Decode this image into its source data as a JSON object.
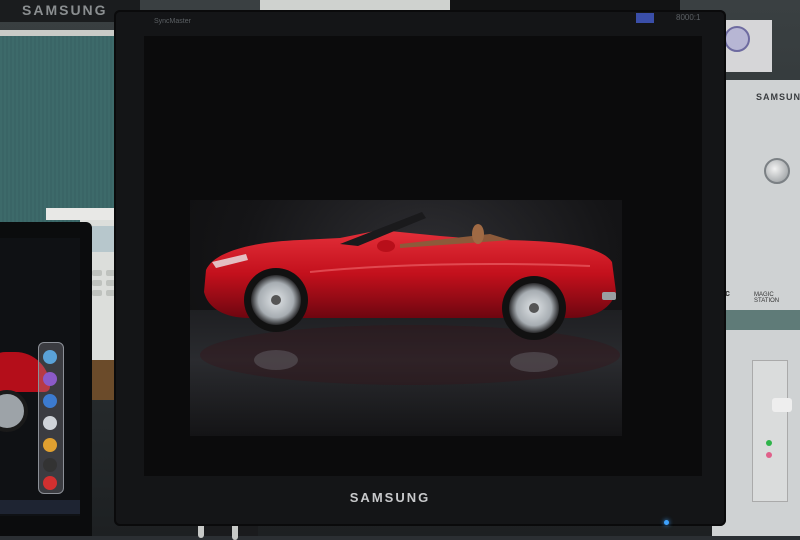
{
  "scene": {
    "background_monitor_brand": "SAMSUNG",
    "main_monitor": {
      "bezel_model": "SyncMaster",
      "contrast_label": "8000:1",
      "brand": "SAMSUNG"
    },
    "tower": {
      "brand": "SAMSUNG",
      "disc_logo": "disc",
      "magic_logo": "MAGIC STATION"
    },
    "wallpaper": {
      "subject": "red convertible sports car",
      "car_color": "#c3101c",
      "wheel_color": "#b9bec3"
    },
    "colors": {
      "power_led": "#3ea3ff",
      "partition": "#3d6a6a"
    }
  }
}
